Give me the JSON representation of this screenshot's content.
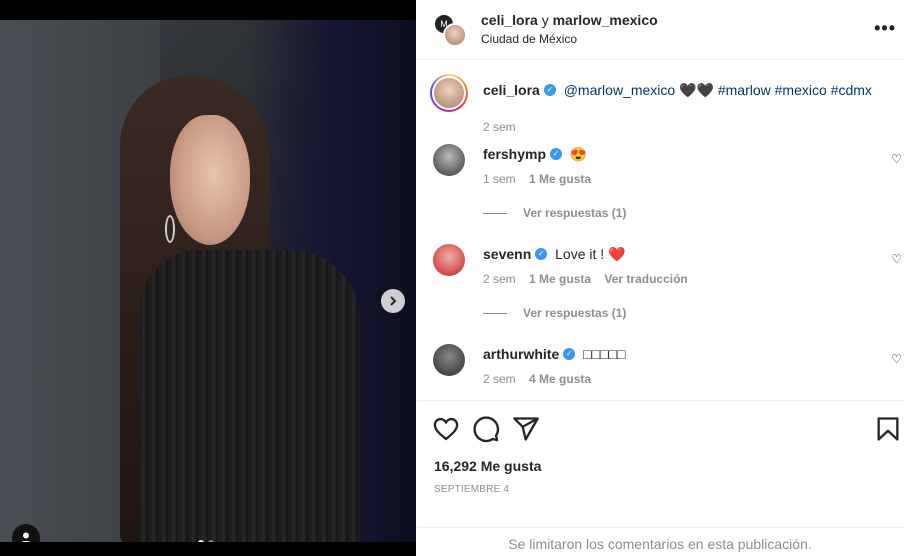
{
  "header": {
    "user1": "celi_lora",
    "joiner": " y ",
    "user2": "marlow_mexico",
    "location": "Ciudad de México",
    "more": "•••"
  },
  "caption": {
    "user": "celi_lora",
    "text_mention": "@marlow_mexico",
    "text_hearts": "🖤🖤",
    "tags": "#marlow #mexico #cdmx",
    "time": "2 sem"
  },
  "comments": [
    {
      "user": "fershymp",
      "text": "😍",
      "time": "1 sem",
      "likes": "1 Me gusta",
      "replies": "Ver respuestas (1)"
    },
    {
      "user": "sevenn",
      "text": "Love it ! ❤️",
      "time": "2 sem",
      "likes": "1 Me gusta",
      "translate": "Ver traducción",
      "replies": "Ver respuestas (1)"
    },
    {
      "user": "arthurwhite",
      "text": "□□□□□",
      "time": "2 sem",
      "likes": "4 Me gusta"
    }
  ],
  "actions": {
    "likes": "16,292 Me gusta",
    "date": "SEPTIEMBRE 4"
  },
  "footer": {
    "limited": "Se limitaron los comentarios en esta publicación."
  },
  "colors": {
    "verified": "#3897f0",
    "hashtag": "#00376b",
    "muted": "#8e8e8e"
  }
}
